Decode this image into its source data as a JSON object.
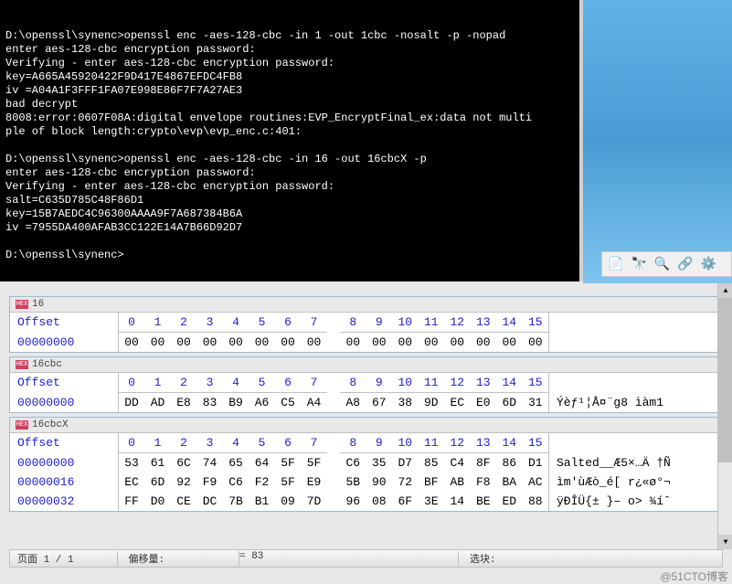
{
  "terminal": {
    "lines": [
      "D:\\openssl\\synenc>openssl enc -aes-128-cbc -in 1 -out 1cbc -nosalt -p -nopad",
      "enter aes-128-cbc encryption password:",
      "Verifying - enter aes-128-cbc encryption password:",
      "key=A665A45920422F9D417E4867EFDC4FB8",
      "iv =A04A1F3FFF1FA07E998E86F7F7A27AE3",
      "bad decrypt",
      "8008:error:0607F08A:digital envelope routines:EVP_EncryptFinal_ex:data not multi",
      "ple of block length:crypto\\evp\\evp_enc.c:401:",
      "",
      "D:\\openssl\\synenc>openssl enc -aes-128-cbc -in 16 -out 16cbcX -p",
      "enter aes-128-cbc encryption password:",
      "Verifying - enter aes-128-cbc encryption password:",
      "salt=C635D785C48F86D1",
      "key=15B7AEDC4C96300AAAA9F7A687384B6A",
      "iv =7955DA400AFAB3CC122E14A7B66D92D7",
      "",
      "D:\\openssl\\synenc>"
    ]
  },
  "toolbar": {
    "icons": [
      "page-icon",
      "binoculars-icon",
      "search-icon",
      "link-icon",
      "gear-icon"
    ]
  },
  "hex": {
    "header_label": "Offset",
    "columns": [
      "0",
      "1",
      "2",
      "3",
      "4",
      "5",
      "6",
      "7",
      "8",
      "9",
      "10",
      "11",
      "12",
      "13",
      "14",
      "15"
    ],
    "panes": [
      {
        "title": "16",
        "rows": [
          {
            "offset": "00000000",
            "bytes": [
              "00",
              "00",
              "00",
              "00",
              "00",
              "00",
              "00",
              "00",
              "00",
              "00",
              "00",
              "00",
              "00",
              "00",
              "00",
              "00"
            ],
            "ascii": ""
          }
        ]
      },
      {
        "title": "16cbc",
        "rows": [
          {
            "offset": "00000000",
            "bytes": [
              "DD",
              "AD",
              "E8",
              "83",
              "B9",
              "A6",
              "C5",
              "A4",
              "A8",
              "67",
              "38",
              "9D",
              "EC",
              "E0",
              "6D",
              "31"
            ],
            "ascii": "Ý­èƒ¹¦Å¤¨g8 ìàm1"
          }
        ]
      },
      {
        "title": "16cbcX",
        "rows": [
          {
            "offset": "00000000",
            "bytes": [
              "53",
              "61",
              "6C",
              "74",
              "65",
              "64",
              "5F",
              "5F",
              "C6",
              "35",
              "D7",
              "85",
              "C4",
              "8F",
              "86",
              "D1"
            ],
            "ascii": "Salted__Æ5×…Ä †Ñ"
          },
          {
            "offset": "00000016",
            "bytes": [
              "EC",
              "6D",
              "92",
              "F9",
              "C6",
              "F2",
              "5F",
              "E9",
              "5B",
              "90",
              "72",
              "BF",
              "AB",
              "F8",
              "BA",
              "AC"
            ],
            "ascii": "ìm'ùÆò_é[ r¿«ø°¬"
          },
          {
            "offset": "00000032",
            "bytes": [
              "FF",
              "D0",
              "CE",
              "DC",
              "7B",
              "B1",
              "09",
              "7D",
              "96",
              "08",
              "6F",
              "3E",
              "14",
              "BE",
              "ED",
              "88"
            ],
            "ascii": "ÿÐÎÜ{± }– o> ¾íˆ"
          }
        ]
      }
    ]
  },
  "status": {
    "page": "页面 1 / 1",
    "offset_label": "偏移量:",
    "size_label": "= 83",
    "sel_label": "选块:"
  },
  "watermark": "@51CTO博客"
}
